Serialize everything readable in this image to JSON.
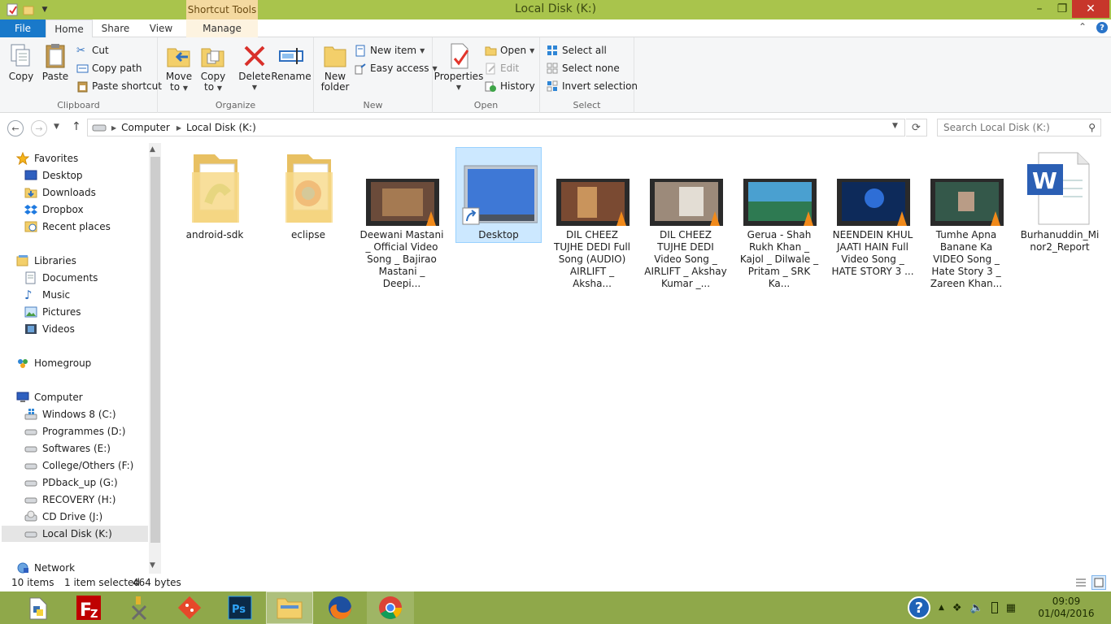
{
  "window": {
    "title": "Local Disk (K:)",
    "contextual_tab_group": "Shortcut Tools",
    "controls": {
      "minimize": "–",
      "maximize": "❐",
      "close": "✕"
    }
  },
  "ribbon_tabs": [
    {
      "label": "File"
    },
    {
      "label": "Home"
    },
    {
      "label": "Share"
    },
    {
      "label": "View"
    },
    {
      "label": "Manage"
    }
  ],
  "ribbon": {
    "clipboard": {
      "label": "Clipboard",
      "copy": "Copy",
      "paste": "Paste",
      "cut": "Cut",
      "copy_path": "Copy path",
      "paste_shortcut": "Paste shortcut"
    },
    "organize": {
      "label": "Organize",
      "move_to": "Move",
      "move_to_2": "to",
      "copy_to": "Copy",
      "copy_to_2": "to",
      "delete": "Delete",
      "rename": "Rename"
    },
    "new": {
      "label": "New",
      "new_folder": "New",
      "new_folder_2": "folder",
      "new_item": "New item",
      "easy_access": "Easy access"
    },
    "open": {
      "label": "Open",
      "properties": "Properties",
      "open": "Open",
      "edit": "Edit",
      "history": "History"
    },
    "select": {
      "label": "Select",
      "select_all": "Select all",
      "select_none": "Select none",
      "invert_selection": "Invert selection"
    }
  },
  "address": {
    "crumbs": [
      "Computer",
      "Local Disk (K:)"
    ],
    "search_placeholder": "Search Local Disk (K:)"
  },
  "nav": {
    "favorites": "Favorites",
    "favorites_items": [
      "Desktop",
      "Downloads",
      "Dropbox",
      "Recent places"
    ],
    "libraries": "Libraries",
    "libraries_items": [
      "Documents",
      "Music",
      "Pictures",
      "Videos"
    ],
    "homegroup": "Homegroup",
    "computer": "Computer",
    "computer_items": [
      "Windows 8 (C:)",
      "Programmes (D:)",
      "Softwares (E:)",
      "College/Others (F:)",
      "PDback_up (G:)",
      "RECOVERY (H:)",
      "CD Drive (J:)",
      "Local Disk (K:)"
    ],
    "network": "Network"
  },
  "files": [
    {
      "name": "android-sdk",
      "type": "folder"
    },
    {
      "name": "eclipse",
      "type": "folder"
    },
    {
      "name": "Deewani Mastani _ Official Video Song _ Bajirao Mastani _ Deepi...",
      "type": "video"
    },
    {
      "name": "Desktop",
      "type": "shortcut"
    },
    {
      "name": "DIL CHEEZ TUJHE DEDI Full Song (AUDIO) AIRLIFT _ Aksha...",
      "type": "video"
    },
    {
      "name": "DIL CHEEZ TUJHE DEDI Video Song _ AIRLIFT _ Akshay Kumar _...",
      "type": "video"
    },
    {
      "name": "Gerua - Shah Rukh Khan _ Kajol _ Dilwale _ Pritam _ SRK Ka...",
      "type": "video"
    },
    {
      "name": "NEENDEIN KHUL JAATI HAIN Full Video Song _ HATE STORY 3 ...",
      "type": "video"
    },
    {
      "name": "Tumhe Apna Banane Ka VIDEO Song _ Hate Story 3 _ Zareen Khan...",
      "type": "video"
    },
    {
      "name": "Burhanuddin_Minor2_Report",
      "type": "word"
    }
  ],
  "status": {
    "count": "10 items",
    "selected": "1 item selected",
    "size": "464 bytes"
  },
  "taskbar": {
    "apps": [
      "python-icon",
      "filezilla-icon",
      "tools-icon",
      "git-icon",
      "photoshop-icon",
      "file-explorer-icon",
      "firefox-icon",
      "chrome-icon"
    ],
    "time": "09:09",
    "date": "01/04/2016"
  },
  "colors": {
    "accent": "#a9c44c",
    "taskbar": "#8fa84a",
    "file_tab": "#1979ca",
    "selection": "#cce8ff",
    "close": "#c7362b"
  }
}
